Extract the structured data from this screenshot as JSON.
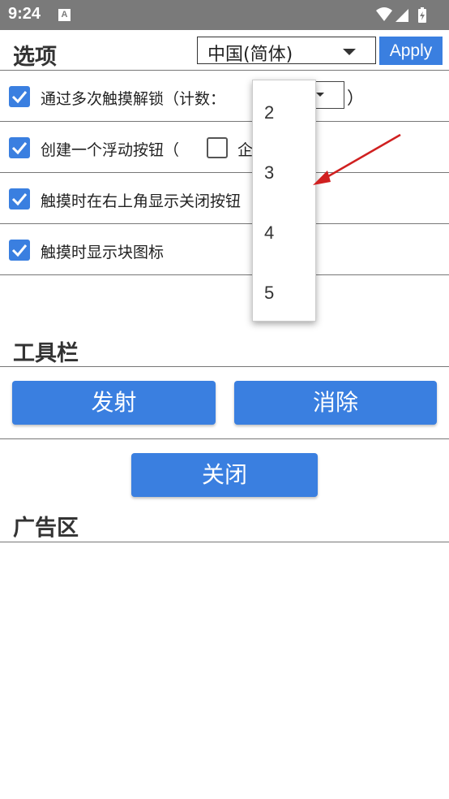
{
  "status_bar": {
    "time": "9:24",
    "notification_glyph": "A"
  },
  "options": {
    "title": "选项",
    "language_select": {
      "value": "中国(简体)"
    },
    "apply_label": "Apply",
    "rows": [
      {
        "label": "通过多次触摸解锁（计数：",
        "checked": true,
        "suffix": "）"
      },
      {
        "label": "创建一个浮动按钮（",
        "checked": true,
        "inner_checkbox_checked": false,
        "inner_label": "企"
      },
      {
        "label": "触摸时在右上角显示关闭按钮",
        "checked": true
      },
      {
        "label": "触摸时显示块图标",
        "checked": true
      }
    ],
    "count_dropdown": {
      "options": [
        "2",
        "3",
        "4",
        "5"
      ]
    }
  },
  "toolbar": {
    "title": "工具栏",
    "fire_label": "发射",
    "clear_label": "消除",
    "close_label": "关闭"
  },
  "ad": {
    "title": "广告区"
  },
  "colors": {
    "accent": "#3a7fe0",
    "status_bar": "#7a7a7a",
    "arrow": "#d02020"
  }
}
